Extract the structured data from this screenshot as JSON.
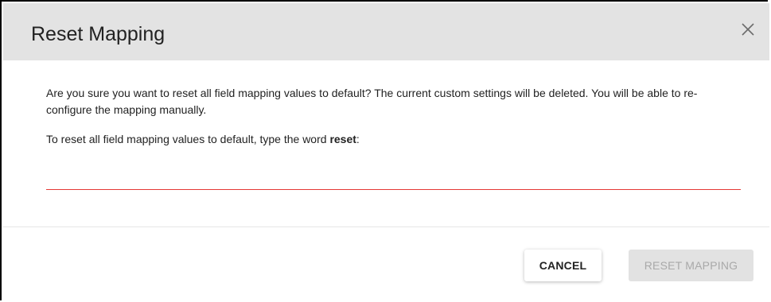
{
  "dialog": {
    "title": "Reset Mapping",
    "message": "Are you sure you want to reset all field mapping values to default? The current custom settings will be deleted. You will be able to re-configure the mapping manually.",
    "instruction_prefix": "To reset all field mapping values to default, type the word ",
    "instruction_keyword": "reset",
    "instruction_suffix": ":",
    "input": {
      "value": "",
      "placeholder": ""
    },
    "buttons": {
      "cancel_label": "CANCEL",
      "reset_label": "RESET MAPPING"
    },
    "icons": {
      "close": "close-icon"
    },
    "colors": {
      "header_bg": "#e3e3e3",
      "input_underline": "#e53935",
      "disabled_button_bg": "#e2e2e2",
      "disabled_button_text": "#a9a9a9"
    }
  }
}
